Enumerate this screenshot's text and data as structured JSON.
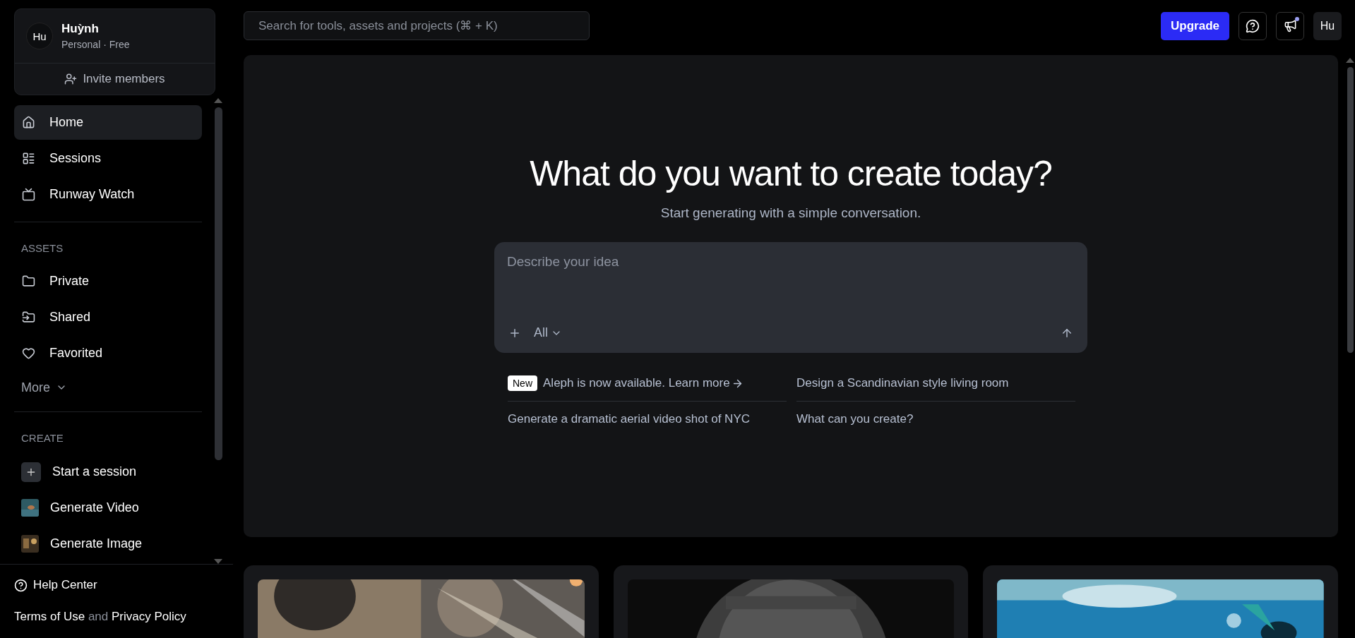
{
  "account": {
    "avatar": "Hu",
    "name": "Huỳnh",
    "plan": "Personal · Free",
    "invite": "Invite members"
  },
  "nav": [
    {
      "label": "Home",
      "selected": true
    },
    {
      "label": "Sessions",
      "selected": false
    },
    {
      "label": "Runway Watch",
      "selected": false
    }
  ],
  "assets": {
    "title": "ASSETS",
    "items": [
      {
        "label": "Private",
        "selected": false
      },
      {
        "label": "Shared",
        "selected": false
      },
      {
        "label": "Favorited",
        "selected": false
      }
    ],
    "more": "More"
  },
  "create": {
    "title": "CREATE",
    "items": [
      {
        "label": "Start a session",
        "kind": "action"
      },
      {
        "label": "Generate Video",
        "kind": "thumb"
      },
      {
        "label": "Generate Image",
        "kind": "thumb"
      }
    ]
  },
  "footer": {
    "help": "Help Center",
    "terms": "Terms of Use",
    "joiner": "and",
    "privacy": "Privacy Policy"
  },
  "search": {
    "placeholder": "Search for tools, assets and projects (⌘ + K)"
  },
  "topbar": {
    "upgrade": "Upgrade",
    "unread": true,
    "avatar": "Hu"
  },
  "hero": {
    "title": "What do you want to create today?",
    "subtitle": "Start generating with a simple conversation."
  },
  "prompt": {
    "placeholder": "Describe your idea",
    "filter": "All"
  },
  "suggestions": [
    {
      "badge": "New",
      "text": "Aleph is now available. Learn more",
      "arrow": true
    },
    {
      "text": "Design a Scandinavian style living room",
      "arrow": false
    },
    {
      "text": "Generate a dramatic aerial video shot of NYC",
      "arrow": false
    },
    {
      "text": "What can you create?",
      "arrow": false
    }
  ]
}
